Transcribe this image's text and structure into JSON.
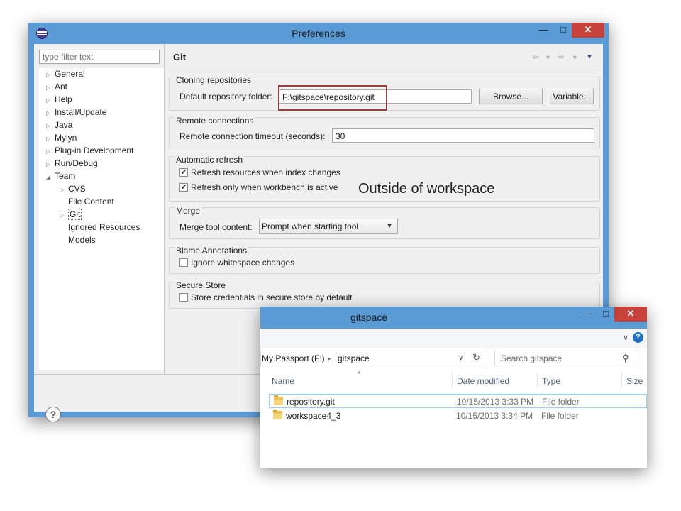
{
  "prefs": {
    "title": "Preferences",
    "window_buttons": {
      "minimize": "—",
      "maximize": "□",
      "close": "✕"
    },
    "filter_placeholder": "type filter text",
    "tree": [
      {
        "label": "General",
        "twisty": "▷"
      },
      {
        "label": "Ant",
        "twisty": "▷"
      },
      {
        "label": "Help",
        "twisty": "▷"
      },
      {
        "label": "Install/Update",
        "twisty": "▷"
      },
      {
        "label": "Java",
        "twisty": "▷"
      },
      {
        "label": "Mylyn",
        "twisty": "▷"
      },
      {
        "label": "Plug-in Development",
        "twisty": "▷"
      },
      {
        "label": "Run/Debug",
        "twisty": "▷"
      },
      {
        "label": "Team",
        "twisty": "◢"
      },
      {
        "label": "CVS",
        "twisty": "▷"
      },
      {
        "label": "File Content",
        "twisty": ""
      },
      {
        "label": "Git",
        "twisty": "▷"
      },
      {
        "label": "Ignored Resources",
        "twisty": ""
      },
      {
        "label": "Models",
        "twisty": ""
      }
    ],
    "page_title": "Git",
    "cloning": {
      "legend": "Cloning repositories",
      "folder_label": "Default repository folder:",
      "folder_value": "F:\\gitspace\\repository.git",
      "browse": "Browse...",
      "variable": "Variable..."
    },
    "remote": {
      "legend": "Remote connections",
      "timeout_label": "Remote connection timeout (seconds):",
      "timeout_value": "30"
    },
    "refresh": {
      "legend": "Automatic refresh",
      "opt1": "Refresh resources when index changes",
      "opt2": "Refresh only when workbench is active",
      "opt1_checked": true,
      "opt2_checked": true
    },
    "merge": {
      "legend": "Merge",
      "tool_label": "Merge tool content:",
      "tool_value": "Prompt when starting tool"
    },
    "blame": {
      "legend": "Blame Annotations",
      "opt": "Ignore whitespace changes",
      "checked": false
    },
    "secure": {
      "legend": "Secure Store",
      "opt": "Store credentials in secure store by default",
      "checked": false
    },
    "help": "?",
    "checkmark": "✔"
  },
  "annotation": "Outside of workspace",
  "explorer": {
    "title": "gitspace",
    "window_buttons": {
      "minimize": "—",
      "maximize": "□",
      "close": "✕"
    },
    "address": {
      "drive": "My Passport (F:)",
      "sep": "▸",
      "folder": "gitspace"
    },
    "search_placeholder": "Search gitspace",
    "columns": [
      "Name",
      "Date modified",
      "Type",
      "Size"
    ],
    "rows": [
      {
        "name": "repository.git",
        "date": "10/15/2013 3:33 PM",
        "type": "File folder",
        "selected": true
      },
      {
        "name": "workspace4_3",
        "date": "10/15/2013 3:34 PM",
        "type": "File folder",
        "selected": false
      }
    ]
  },
  "colors": {
    "titlebar": "#5b9bd5",
    "close": "#c7423a",
    "highlight": "#9a3f3f"
  }
}
